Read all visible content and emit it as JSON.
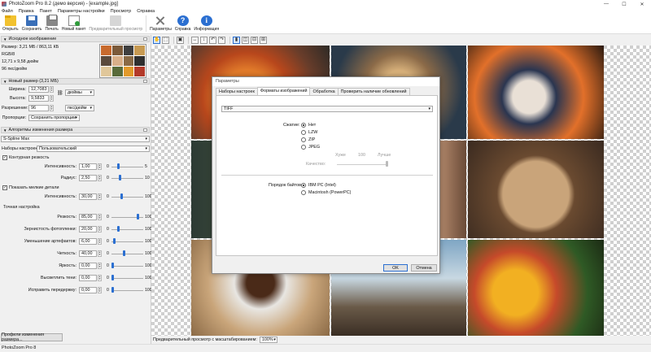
{
  "window": {
    "title": "PhotoZoom Pro 8.2 (демо версия) - [example.jpg]",
    "min": "—",
    "max": "☐",
    "close": "✕"
  },
  "menu": [
    "Файл",
    "Правка",
    "Пакет",
    "Параметры настройки",
    "Просмотр",
    "Справка"
  ],
  "toolbar": {
    "open": "Открыть",
    "save": "Сохранить",
    "print": "Печать",
    "new_batch": "Новый пакет",
    "preview": "Предварительный просмотр",
    "settings": "Параметры",
    "help": "Справка",
    "info": "Информация",
    "help_glyph": "?",
    "info_glyph": "i"
  },
  "source": {
    "header": "Исходное изображение",
    "size": "Размер: 3,21 МБ / 863,11 КБ",
    "mode": "RGB/8",
    "dims": "12,71 x 9,58 дюйм",
    "res": "96 пкс/дюйм"
  },
  "new_size": {
    "header": "Новый размер (3,21 МБ)",
    "width_label": "Ширина:",
    "width_value": "12,7083",
    "height_label": "Высота:",
    "height_value": "9,5833",
    "unit": "дюймы",
    "res_label": "Разрешение:",
    "res_value": "96",
    "res_unit": "пкс/дюйм",
    "prop_label": "Пропорции:",
    "prop_value": "Сохранить пропорции"
  },
  "algorithms": {
    "header": "Алгоритмы изменения размера",
    "method": "S-Spline Max",
    "presets_label": "Наборы настроек:",
    "presets_value": "Пользовательский",
    "contour": {
      "label": "Контурная резкость",
      "checked": true
    },
    "intensity": {
      "label": "Интенсивность:",
      "value": "1,00",
      "min": "0",
      "max": "5",
      "level": 0.2
    },
    "radius": {
      "label": "Радиус:",
      "value": "2,50",
      "min": "0",
      "max": "10",
      "level": 0.25
    },
    "details": {
      "label": "Показать мелкие детали",
      "checked": true
    },
    "details_intensity": {
      "label": "Интенсивность:",
      "value": "30,00",
      "min": "0",
      "max": "100",
      "level": 0.3
    },
    "fine_header": "Точная настройка",
    "fine": [
      {
        "label": "Резкость:",
        "value": "85,00",
        "min": "0",
        "max": "100",
        "level": 0.85
      },
      {
        "label": "Зернистость фотопленки:",
        "value": "20,00",
        "min": "0",
        "max": "100",
        "level": 0.2
      },
      {
        "label": "Уменьшение артефактов:",
        "value": "6,00",
        "min": "0",
        "max": "100",
        "level": 0.06
      },
      {
        "label": "Четкость:",
        "value": "40,00",
        "min": "0",
        "max": "100",
        "level": 0.4
      },
      {
        "label": "Яркость:",
        "value": "0,00",
        "min": "0",
        "max": "100",
        "level": 0.0
      },
      {
        "label": "Высветлить тени:",
        "value": "0,00",
        "min": "0",
        "max": "100",
        "level": 0.0
      },
      {
        "label": "Исправить передержку:",
        "value": "0,00",
        "min": "0",
        "max": "100",
        "level": 0.0
      }
    ],
    "profiles_button": "Профили изменения размера..."
  },
  "zoom": {
    "label": "Предварительный просмотр с масштабированием:",
    "value": "100%"
  },
  "status": "PhotoZoom Pro 8",
  "dialog": {
    "title": "Параметры",
    "tabs": [
      "Наборы настроек",
      "Форматы изображений",
      "Обработка",
      "Проверить наличие обновлений"
    ],
    "active_tab": 1,
    "format": "TIFF",
    "compression_label": "Сжатие:",
    "compression_options": [
      "Нет",
      "LZW",
      "ZIP",
      "JPEG"
    ],
    "compression_selected": 0,
    "quality_label": "Качество:",
    "quality_worse": "Хуже",
    "quality_value": "100",
    "quality_better": "Лучше",
    "byte_order_label": "Порядок байтов:",
    "byte_order_options": [
      "IBM PC (Intel)",
      "Macintosh (PowerPC)"
    ],
    "byte_order_selected": 0,
    "ok": "OK",
    "cancel": "Отмена"
  },
  "colors": {
    "accent": "#2b6fd1",
    "panel": "#f0f0f0",
    "checker": "#cfcfcf"
  }
}
